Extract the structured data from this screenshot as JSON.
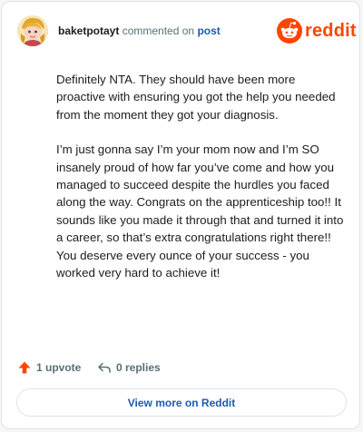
{
  "header": {
    "username": "baketpotayt",
    "action_text": "commented on",
    "post_link": "post",
    "logo_text": "reddit",
    "brand_color": "#ff4500"
  },
  "comment": {
    "paragraphs": [
      "Definitely NTA. They should have been more proactive with ensuring you got the help you needed from the moment they got your diagnosis.",
      "I’m just gonna say I’m your mom now and I’m SO insanely proud of how far you’ve come and how you managed to succeed despite the hurdles you faced along the way. Congrats on the apprenticeship too!! It sounds like you made it through that and turned it into a career, so that’s extra congratulations right there!! You deserve every ounce of your success - you worked very hard to achieve it!"
    ]
  },
  "actions": {
    "upvotes": "1 upvote",
    "replies": "0 replies",
    "upvote_icon": "upvote-arrow-icon",
    "reply_icon": "reply-icon"
  },
  "footer": {
    "button_label": "View more on Reddit"
  }
}
